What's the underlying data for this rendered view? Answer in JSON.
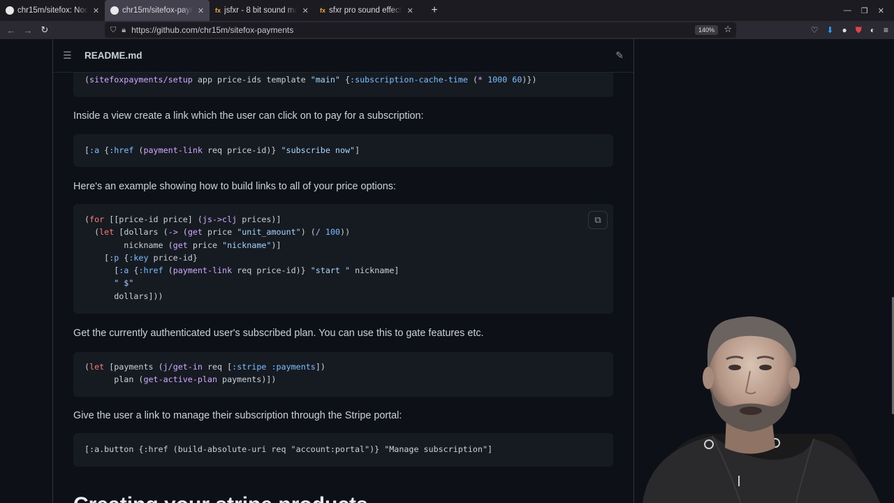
{
  "tabs": [
    {
      "title": "chr15m/sitefox: Node",
      "active": false,
      "icon": "github-icon"
    },
    {
      "title": "chr15m/sitefox-payme",
      "active": true,
      "icon": "github-icon"
    },
    {
      "title": "jsfxr - 8 bit sound make",
      "active": false,
      "icon": "fx-icon"
    },
    {
      "title": "sfxr pro sound effects p",
      "active": false,
      "icon": "fx-icon"
    }
  ],
  "fx_icon_text": "fx",
  "url": "https://github.com/chr15m/sitefox-payments",
  "zoom": "140%",
  "readme": {
    "title": "README.md"
  },
  "paragraphs": {
    "p1": "Inside a view create a link which the user can click on to pay for a subscription:",
    "p2": "Here's an example showing how to build links to all of your price options:",
    "p3": "Get the currently authenticated user's subscribed plan. You can use this to gate features etc.",
    "p4": "Give the user a link to manage their subscription through the Stripe portal:"
  },
  "code": {
    "c0_line1": "(sitefoxpayments/setup app price-ids template \"main\" {:subscription-cache-time (* 1000 60)})",
    "c1_line1": "[:a {:href (payment-link req price-id)} \"subscribe now\"]",
    "c2_lines": [
      "(for [[price-id price] (js->clj prices)]",
      "  (let [dollars (-> (get price \"unit_amount\") (/ 100))",
      "        nickname (get price \"nickname\")]",
      "    [:p {:key price-id}",
      "      [:a {:href (payment-link req price-id)} \"start \" nickname]",
      "      \" $\"",
      "      dollars]))"
    ],
    "c3_lines": [
      "(let [payments (j/get-in req [:stripe :payments])",
      "      plan (get-active-plan payments)])"
    ],
    "c4_line1": "[:a.button {:href (build-absolute-uri req \"account:portal\")} \"Manage subscription\"]"
  },
  "heading_partial": "Creating your stripe products"
}
